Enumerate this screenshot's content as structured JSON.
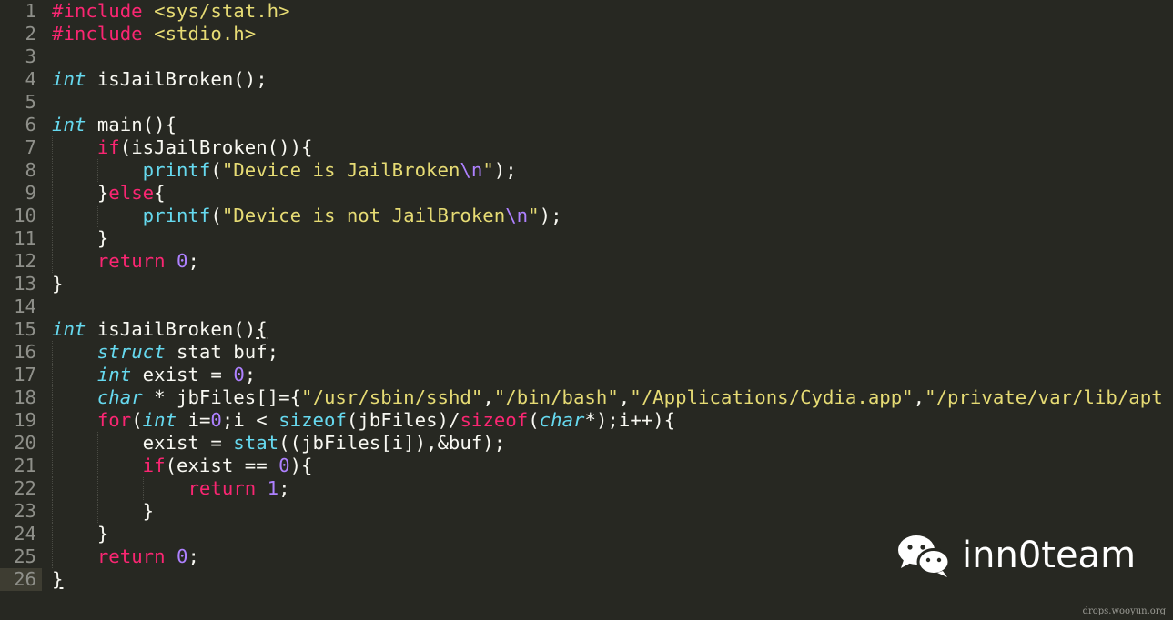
{
  "editor": {
    "theme_colors": {
      "background": "#272822",
      "gutter": "#8f908a",
      "plain": "#f8f8f2",
      "keyword": "#f92672",
      "string": "#e6db74",
      "number": "#ae81ff",
      "type": "#66d9ef"
    },
    "current_line": 26,
    "lines": [
      {
        "num": "1",
        "indent": 0,
        "tokens": [
          [
            "#include ",
            "k"
          ],
          [
            "<sys/stat.h>",
            "s"
          ]
        ]
      },
      {
        "num": "2",
        "indent": 0,
        "tokens": [
          [
            "#include ",
            "k"
          ],
          [
            "<stdio.h>",
            "s"
          ]
        ]
      },
      {
        "num": "3",
        "indent": 0,
        "tokens": []
      },
      {
        "num": "4",
        "indent": 0,
        "tokens": [
          [
            "int",
            "t"
          ],
          [
            " isJailBroken();",
            "p"
          ]
        ]
      },
      {
        "num": "5",
        "indent": 0,
        "tokens": []
      },
      {
        "num": "6",
        "indent": 0,
        "tokens": [
          [
            "int",
            "t"
          ],
          [
            " main(){",
            "p"
          ]
        ]
      },
      {
        "num": "7",
        "indent": 1,
        "tokens": [
          [
            "if",
            "k"
          ],
          [
            "(isJailBroken()){",
            "p"
          ]
        ]
      },
      {
        "num": "8",
        "indent": 2,
        "tokens": [
          [
            "printf",
            "f"
          ],
          [
            "(",
            "p"
          ],
          [
            "\"Device is JailBroken",
            "s"
          ],
          [
            "\\n",
            "e"
          ],
          [
            "\"",
            "s"
          ],
          [
            ");",
            "p"
          ]
        ]
      },
      {
        "num": "9",
        "indent": 1,
        "tokens": [
          [
            "}",
            "p"
          ],
          [
            "else",
            "k"
          ],
          [
            "{",
            "p"
          ]
        ]
      },
      {
        "num": "10",
        "indent": 2,
        "tokens": [
          [
            "printf",
            "f"
          ],
          [
            "(",
            "p"
          ],
          [
            "\"Device is not JailBroken",
            "s"
          ],
          [
            "\\n",
            "e"
          ],
          [
            "\"",
            "s"
          ],
          [
            ");",
            "p"
          ]
        ]
      },
      {
        "num": "11",
        "indent": 1,
        "tokens": [
          [
            "}",
            "p"
          ]
        ]
      },
      {
        "num": "12",
        "indent": 1,
        "tokens": [
          [
            "return ",
            "k"
          ],
          [
            "0",
            "n"
          ],
          [
            ";",
            "p"
          ]
        ]
      },
      {
        "num": "13",
        "indent": 0,
        "tokens": [
          [
            "}",
            "p"
          ]
        ]
      },
      {
        "num": "14",
        "indent": 0,
        "tokens": []
      },
      {
        "num": "15",
        "indent": 0,
        "tokens": [
          [
            "int",
            "t"
          ],
          [
            " isJailBroken()",
            "p"
          ],
          [
            "{",
            "u"
          ]
        ]
      },
      {
        "num": "16",
        "indent": 1,
        "tokens": [
          [
            "struct",
            "t"
          ],
          [
            " stat buf;",
            "p"
          ]
        ]
      },
      {
        "num": "17",
        "indent": 1,
        "tokens": [
          [
            "int",
            "t"
          ],
          [
            " exist = ",
            "p"
          ],
          [
            "0",
            "n"
          ],
          [
            ";",
            "p"
          ]
        ]
      },
      {
        "num": "18",
        "indent": 1,
        "tokens": [
          [
            "char",
            "t"
          ],
          [
            " * jbFiles[]={",
            "p"
          ],
          [
            "\"/usr/sbin/sshd\"",
            "s"
          ],
          [
            ",",
            "p"
          ],
          [
            "\"/bin/bash\"",
            "s"
          ],
          [
            ",",
            "p"
          ],
          [
            "\"/Applications/Cydia.app\"",
            "s"
          ],
          [
            ",",
            "p"
          ],
          [
            "\"/private/var/lib/apt",
            "s"
          ]
        ]
      },
      {
        "num": "19",
        "indent": 1,
        "tokens": [
          [
            "for",
            "k"
          ],
          [
            "(",
            "p"
          ],
          [
            "int",
            "t"
          ],
          [
            " i=",
            "p"
          ],
          [
            "0",
            "n"
          ],
          [
            ";i < ",
            "p"
          ],
          [
            "sizeof",
            "f"
          ],
          [
            "(jbFiles)/",
            "p"
          ],
          [
            "sizeof",
            "k"
          ],
          [
            "(",
            "p"
          ],
          [
            "char",
            "t"
          ],
          [
            "*);i++){",
            "p"
          ]
        ]
      },
      {
        "num": "20",
        "indent": 2,
        "tokens": [
          [
            "exist = ",
            "p"
          ],
          [
            "stat",
            "f"
          ],
          [
            "((jbFiles[i]),&buf);",
            "p"
          ]
        ]
      },
      {
        "num": "21",
        "indent": 2,
        "tokens": [
          [
            "if",
            "k"
          ],
          [
            "(exist == ",
            "p"
          ],
          [
            "0",
            "n"
          ],
          [
            "){",
            "p"
          ]
        ]
      },
      {
        "num": "22",
        "indent": 3,
        "tokens": [
          [
            "return ",
            "k"
          ],
          [
            "1",
            "n"
          ],
          [
            ";",
            "p"
          ]
        ]
      },
      {
        "num": "23",
        "indent": 2,
        "tokens": [
          [
            "}",
            "p"
          ]
        ]
      },
      {
        "num": "24",
        "indent": 1,
        "tokens": [
          [
            "}",
            "p"
          ]
        ]
      },
      {
        "num": "25",
        "indent": 1,
        "tokens": [
          [
            "return ",
            "k"
          ],
          [
            "0",
            "n"
          ],
          [
            ";",
            "p"
          ]
        ]
      },
      {
        "num": "26",
        "indent": 0,
        "tokens": [
          [
            "}",
            "u"
          ]
        ]
      }
    ]
  },
  "watermark": {
    "icon": "wechat-icon",
    "text": "inn0team"
  },
  "site_credit": "drops.wooyun.org"
}
